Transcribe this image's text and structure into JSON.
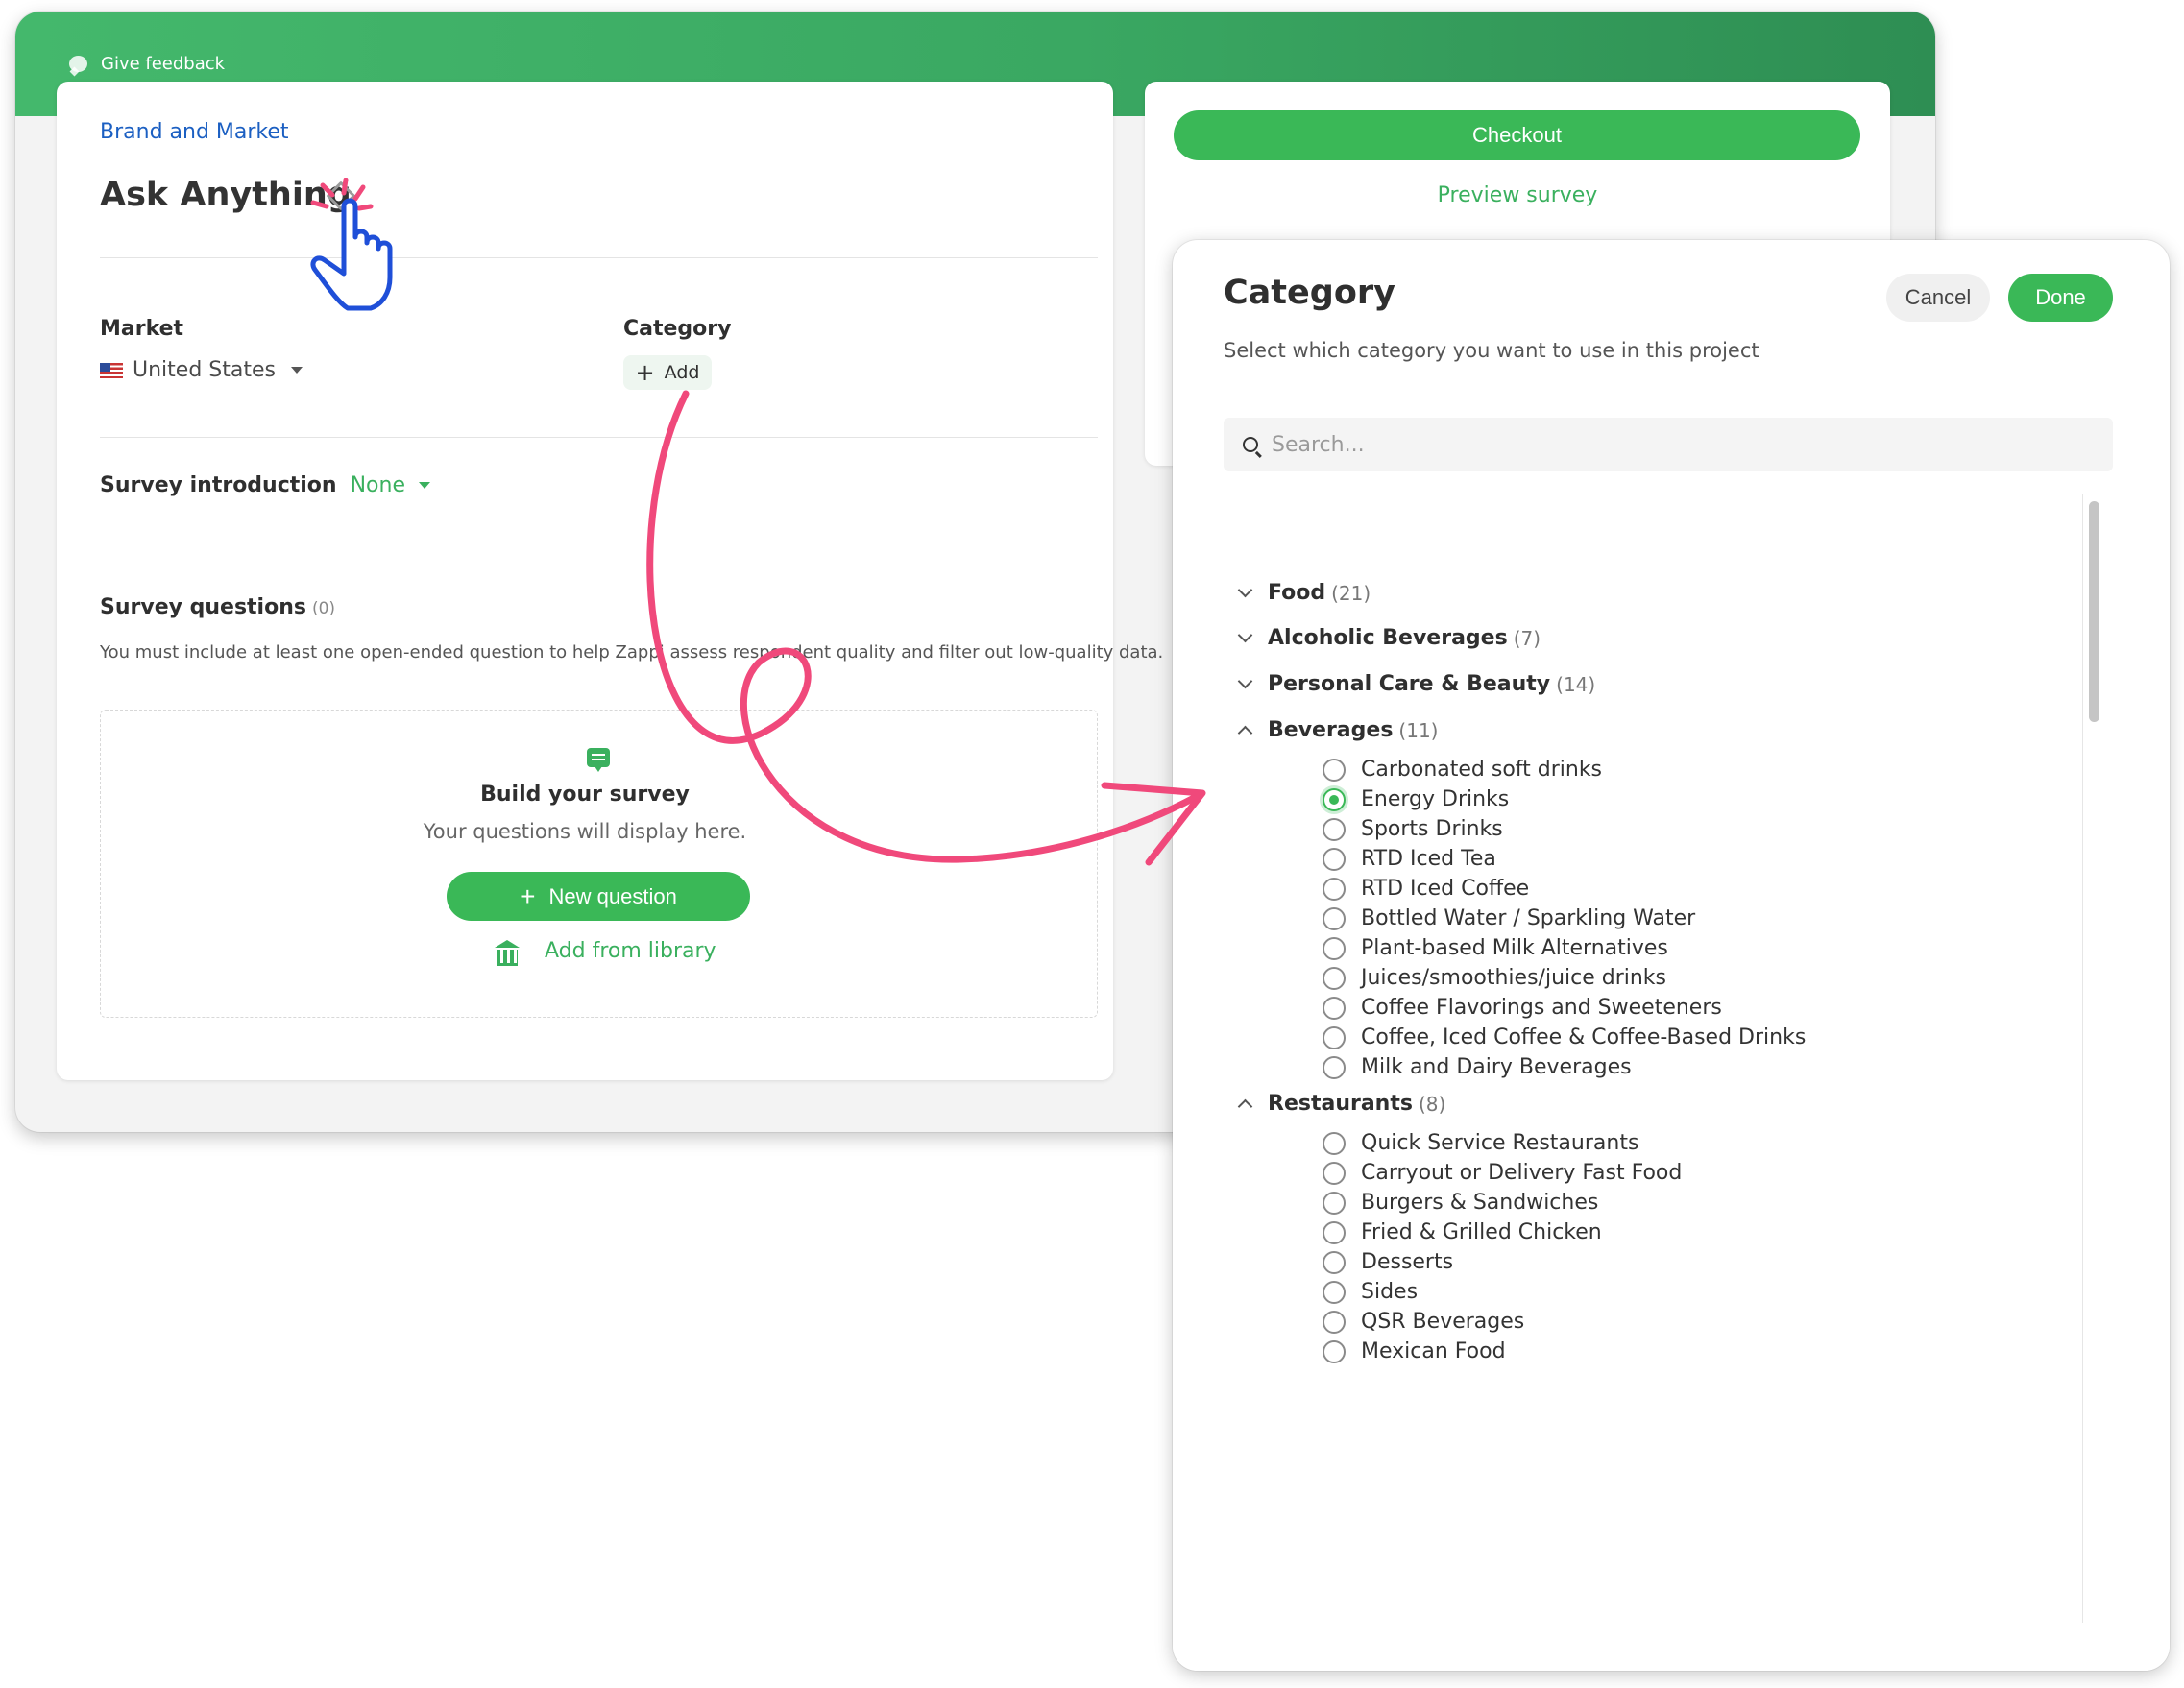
{
  "header": {
    "feedback_label": "Give feedback",
    "banner_color": "#3aa862"
  },
  "builder": {
    "breadcrumb": "Brand and Market",
    "title": "Ask Anything",
    "market_label": "Market",
    "market_value": "United States",
    "category_label": "Category",
    "add_label": "Add",
    "survey_intro_label": "Survey introduction",
    "survey_intro_value": "None",
    "survey_questions_label": "Survey questions",
    "survey_questions_count": "(0)",
    "survey_questions_desc": "You must include at least one open-ended question to help Zappi assess respondent quality and filter out low-quality data.",
    "build_title": "Build your survey",
    "build_sub": "Your questions will display here.",
    "new_question_label": "New question",
    "library_label": "Add from library"
  },
  "sidebar": {
    "checkout_label": "Checkout",
    "preview_label": "Preview survey"
  },
  "modal": {
    "title": "Category",
    "subtitle": "Select which category you want to use in this project",
    "cancel_label": "Cancel",
    "done_label": "Done",
    "search_placeholder": "Search...",
    "groups": [
      {
        "name": "Food",
        "count": "(21)",
        "expanded": false
      },
      {
        "name": "Alcoholic Beverages",
        "count": "(7)",
        "expanded": false
      },
      {
        "name": "Personal Care & Beauty",
        "count": "(14)",
        "expanded": false
      },
      {
        "name": "Beverages",
        "count": "(11)",
        "expanded": true
      },
      {
        "name": "Restaurants",
        "count": "(8)",
        "expanded": true
      }
    ],
    "beverages_options": [
      "Carbonated soft drinks",
      "Energy Drinks",
      "Sports Drinks",
      "RTD Iced Tea",
      "RTD Iced Coffee",
      "Bottled Water / Sparkling Water",
      "Plant-based Milk Alternatives",
      "Juices/smoothies/juice drinks",
      "Coffee Flavorings and Sweeteners",
      "Coffee, Iced Coffee & Coffee-Based Drinks",
      "Milk and Dairy Beverages"
    ],
    "selected_option": "Energy Drinks",
    "restaurants_options": [
      "Quick Service Restaurants",
      "Carryout or Delivery Fast Food",
      "Burgers & Sandwiches",
      "Fried & Grilled Chicken",
      "Desserts",
      "Sides",
      "QSR Beverages",
      "Mexican Food"
    ]
  },
  "colors": {
    "accent": "#3ab857",
    "link": "#1b5fc2",
    "annotation": "#f0497b",
    "cursor": "#1f4fd8"
  },
  "icons": {
    "feedback": "chat-bubble-icon",
    "pencil": "pencil-icon",
    "cursor": "hand-pointer-icon",
    "search": "search-icon",
    "library": "bank-icon",
    "build": "chat-icon"
  }
}
